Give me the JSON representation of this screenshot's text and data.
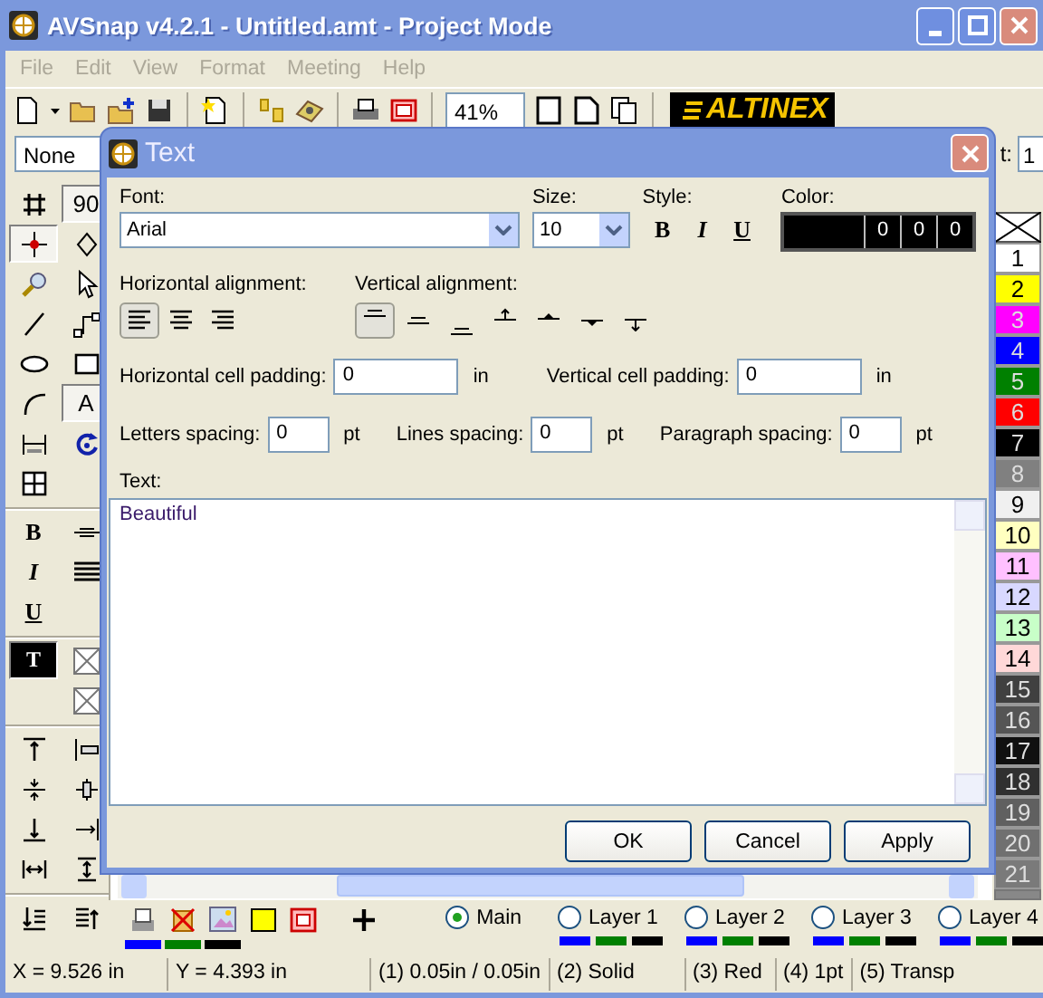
{
  "window": {
    "title": "AVSnap v4.2.1 - Untitled.amt - Project Mode"
  },
  "menu": [
    {
      "label": "File",
      "disabled": true
    },
    {
      "label": "Edit",
      "disabled": true
    },
    {
      "label": "View",
      "disabled": true
    },
    {
      "label": "Format",
      "disabled": true
    },
    {
      "label": "Meeting",
      "disabled": true
    },
    {
      "label": "Help",
      "disabled": true
    }
  ],
  "toolbar": {
    "zoom": "41%",
    "logo": "ALTINEX"
  },
  "toolbar2": {
    "layer_select": "None",
    "field_label": "t:",
    "field_value": "1"
  },
  "toolbox": [
    [
      {
        "kind": "icon",
        "selected": false
      },
      {
        "kind": "glyph",
        "text": "90",
        "selected": true
      },
      {
        "kind": "icon",
        "selected": true
      },
      {
        "kind": "icon",
        "selected": false
      },
      {
        "kind": "icon",
        "selected": false
      },
      {
        "kind": "icon",
        "selected": false
      },
      {
        "kind": "icon",
        "selected": false
      },
      {
        "kind": "icon",
        "selected": false
      },
      {
        "kind": "icon",
        "selected": false
      },
      {
        "kind": "icon",
        "selected": false
      },
      {
        "kind": "icon",
        "selected": false
      },
      {
        "kind": "glyph",
        "text": "A",
        "selected": true
      },
      {
        "kind": "icon",
        "selected": false
      },
      {
        "kind": "icon",
        "selected": false
      },
      {
        "kind": "icon",
        "selected": false
      }
    ],
    [
      {
        "kind": "glyph",
        "text": "B",
        "selected": false
      },
      {
        "kind": "icon",
        "selected": false
      },
      {
        "kind": "glyph",
        "text": "I",
        "selected": false
      },
      {
        "kind": "icon",
        "selected": false
      },
      {
        "kind": "glyph",
        "text": "U",
        "selected": false
      }
    ],
    [
      {
        "kind": "glyph",
        "text": "T",
        "selected": true
      },
      {
        "kind": "icon",
        "selected": false
      },
      {
        "kind": "empty"
      },
      {
        "kind": "icon",
        "selected": false
      }
    ],
    [
      {
        "kind": "icon",
        "selected": false
      },
      {
        "kind": "icon",
        "selected": false
      },
      {
        "kind": "icon",
        "selected": false
      },
      {
        "kind": "icon",
        "selected": false
      },
      {
        "kind": "icon",
        "selected": false
      },
      {
        "kind": "icon",
        "selected": false
      },
      {
        "kind": "icon",
        "selected": false
      },
      {
        "kind": "icon",
        "selected": false
      }
    ],
    [
      {
        "kind": "icon",
        "selected": false
      },
      {
        "kind": "icon",
        "selected": false
      }
    ]
  ],
  "palette": [
    {
      "kind": "none"
    },
    {
      "kind": "color",
      "label": "1",
      "color": "#ffffff"
    },
    {
      "kind": "color",
      "label": "2",
      "color": "#ffff00"
    },
    {
      "kind": "color",
      "label": "3",
      "color": "#ff00ff"
    },
    {
      "kind": "color",
      "label": "4",
      "color": "#0000ff"
    },
    {
      "kind": "color",
      "label": "5",
      "color": "#008000"
    },
    {
      "kind": "color",
      "label": "6",
      "color": "#ff0000"
    },
    {
      "kind": "color",
      "label": "7",
      "color": "#000000"
    },
    {
      "kind": "color",
      "label": "8",
      "color": "#808080"
    },
    {
      "kind": "color",
      "label": "9",
      "color": "#f0f0f0"
    },
    {
      "kind": "color",
      "label": "10",
      "color": "#ffffc0"
    },
    {
      "kind": "color",
      "label": "11",
      "color": "#ffc0ff"
    },
    {
      "kind": "color",
      "label": "12",
      "color": "#d8d8ff"
    },
    {
      "kind": "color",
      "label": "13",
      "color": "#c8ffc8"
    },
    {
      "kind": "color",
      "label": "14",
      "color": "#ffd8d8"
    },
    {
      "kind": "color",
      "label": "15",
      "color": "#404040"
    },
    {
      "kind": "color",
      "label": "16",
      "color": "#555555"
    },
    {
      "kind": "color",
      "label": "17",
      "color": "#101010"
    },
    {
      "kind": "color",
      "label": "18",
      "color": "#303030"
    },
    {
      "kind": "color",
      "label": "19",
      "color": "#606060"
    },
    {
      "kind": "color",
      "label": "20",
      "color": "#707070"
    },
    {
      "kind": "color",
      "label": "21",
      "color": "#7a7a7a"
    }
  ],
  "layer_bar": {
    "line_colors": [
      {
        "color": "#0000ff"
      },
      {
        "color": "#008000"
      },
      {
        "color": "#000000"
      }
    ],
    "layers": [
      {
        "label": "Main",
        "selected": true
      },
      {
        "label": "Layer 1",
        "selected": false,
        "colors": [
          {
            "color": "#0000ff"
          },
          {
            "color": "#008000"
          },
          {
            "color": "#000000"
          }
        ]
      },
      {
        "label": "Layer 2",
        "selected": false,
        "colors": [
          {
            "color": "#0000ff"
          },
          {
            "color": "#008000"
          },
          {
            "color": "#000000"
          }
        ]
      },
      {
        "label": "Layer 3",
        "selected": false,
        "colors": [
          {
            "color": "#0000ff"
          },
          {
            "color": "#008000"
          },
          {
            "color": "#000000"
          }
        ]
      },
      {
        "label": "Layer 4",
        "selected": false,
        "colors": [
          {
            "color": "#0000ff"
          },
          {
            "color": "#008000"
          },
          {
            "color": "#000000"
          }
        ]
      }
    ]
  },
  "status_bar": [
    "X = 9.526 in",
    "Y = 4.393 in",
    "(1) 0.05in / 0.05in",
    "(2) Solid",
    "(3) Red",
    "(4) 1pt",
    "(5) Transp"
  ],
  "dialog": {
    "title": "Text",
    "font_label": "Font:",
    "font_value": "Arial",
    "size_label": "Size:",
    "size_value": "10",
    "style_label": "Style:",
    "style_buttons": [
      {
        "text": "B"
      },
      {
        "text": "I"
      },
      {
        "text": "U"
      }
    ],
    "color_label": "Color:",
    "color": {
      "color": "#000000",
      "values": [
        "0",
        "0",
        "0"
      ]
    },
    "h_align_label": "Horizontal alignment:",
    "h_align": [
      {
        "selected": true
      },
      {
        "selected": false
      },
      {
        "selected": false
      }
    ],
    "v_align_label": "Vertical alignment:",
    "v_align": [
      {
        "selected": true
      },
      {
        "selected": false
      },
      {
        "selected": false
      },
      {
        "selected": false
      },
      {
        "selected": false
      },
      {
        "selected": false
      },
      {
        "selected": false
      }
    ],
    "padding_fields": [
      {
        "label": "Horizontal cell padding:",
        "value": "0",
        "unit": "in"
      },
      {
        "label": "Vertical cell padding:",
        "value": "0",
        "unit": "in"
      }
    ],
    "spacing_fields": [
      {
        "label": "Letters spacing:",
        "value": "0",
        "unit": "pt"
      },
      {
        "label": "Lines spacing:",
        "value": "0",
        "unit": "pt"
      },
      {
        "label": "Paragraph spacing:",
        "value": "0",
        "unit": "pt"
      }
    ],
    "text_label": "Text:",
    "text_value": "Beautiful",
    "buttons": [
      "OK",
      "Cancel",
      "Apply"
    ]
  }
}
